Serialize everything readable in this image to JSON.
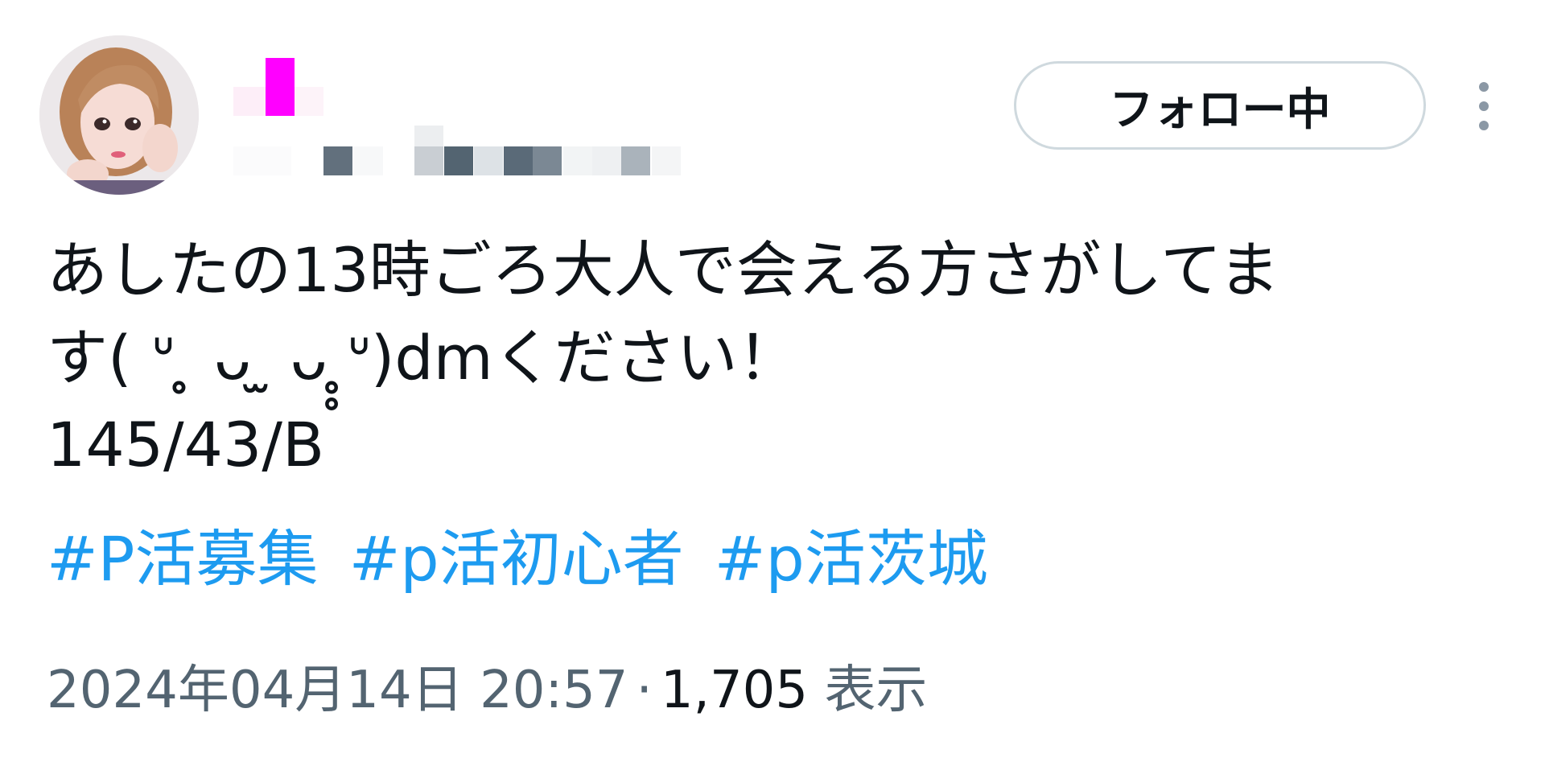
{
  "user": {
    "display_name": "",
    "username": "",
    "follow_label": "フォロー中"
  },
  "tweet": {
    "text_lines": [
      "あしたの13時ごろ大人で会える方さがしてま",
      "す( ᐡ ̥̥ ᴗ ̫ ᴗ ̥̥ᐡ)dmください！",
      "145/43/B"
    ],
    "hashtags": [
      "#P活募集",
      "#p活初心者",
      "#p活茨城"
    ]
  },
  "meta": {
    "timestamp": "2024年04月14日 20:57",
    "separator": "·",
    "views_count": "1,705",
    "views_label": "表示"
  },
  "icons": {
    "more": "more-vertical-icon",
    "avatar": "profile-photo"
  },
  "colors": {
    "accent": "#1d9bf0",
    "text": "#0f1419",
    "secondary": "#536471",
    "border": "#cfd9de",
    "redacted_name": "#ff00ff"
  }
}
